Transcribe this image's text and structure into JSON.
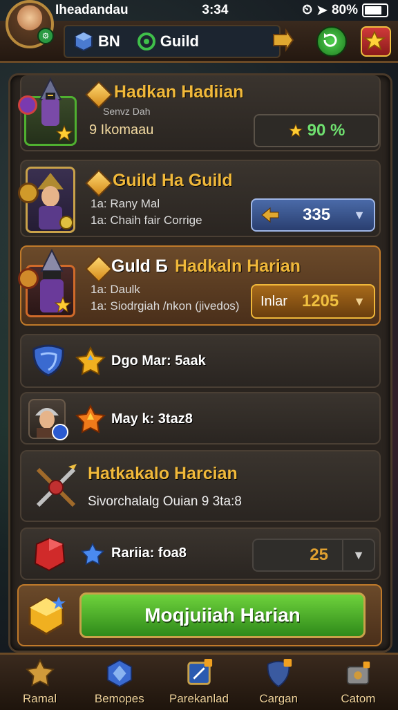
{
  "status_bar": {
    "carrier": "Iheadandau",
    "time": "3:34",
    "battery": "80%"
  },
  "header": {
    "tabs": [
      {
        "label": "BN",
        "icon": "blue-cube-icon"
      },
      {
        "label": "Guild",
        "icon": "guild-emblem-icon"
      }
    ]
  },
  "rows": [
    {
      "title": "Hadkan Hadiian",
      "sub1": "Senvz Dah",
      "sub2": "9 Ikomaau",
      "value": "90 %"
    },
    {
      "title": "Guild Ha Guild",
      "sub1": "1a: Rany Mal",
      "sub2": "1a: Chaih fair Corrige",
      "value": "335"
    },
    {
      "title_white": "Guld Б",
      "title": "Hadkaln Harian",
      "sub1": "1a: Daulk",
      "sub2": "1a: Siodrgiah /nkon (jivedos)",
      "value_label": "Inlar",
      "value": "1205"
    },
    {
      "label": "Dgo Mar: 5aak"
    },
    {
      "label": "May k: 3taz8"
    },
    {
      "title": "Hatkakalo Harcian",
      "sub1": "Sivorchalalg Ouian 9 3ta:8"
    },
    {
      "label": "Rariia: foa8",
      "value": "25"
    }
  ],
  "main_button": "Moqjuiiah Harian",
  "nav": [
    {
      "label": "Ramal"
    },
    {
      "label": "Bemopes"
    },
    {
      "label": "Parekanlad"
    },
    {
      "label": "Cargan"
    },
    {
      "label": "Catom"
    }
  ],
  "colors": {
    "accent": "#f0b83a",
    "button": "#4fb02c",
    "highlight": "#c07a2a"
  }
}
